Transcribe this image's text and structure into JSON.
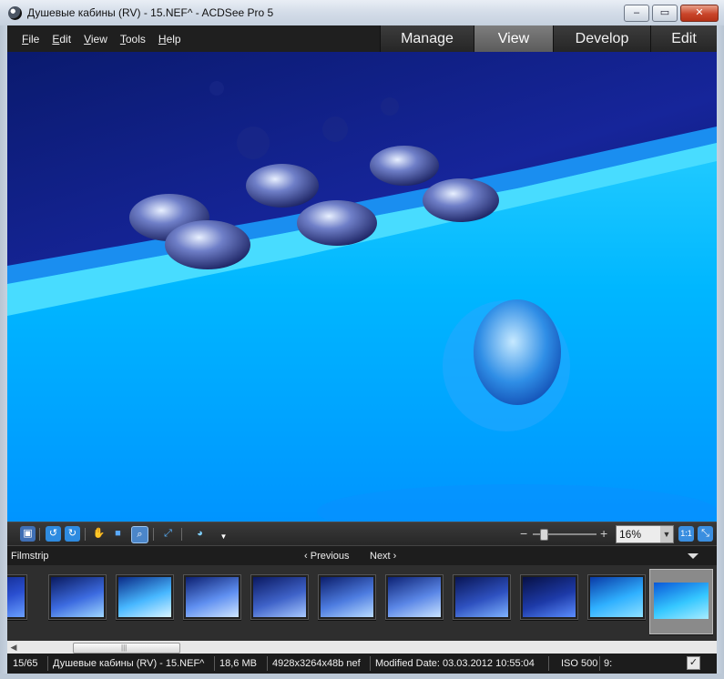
{
  "window": {
    "title": "Душевые кабины (RV) - 15.NEF^ - ACDSee Pro 5",
    "minimize_glyph": "‒",
    "maximize_glyph": "▭",
    "close_glyph": "✕"
  },
  "menu": [
    "File",
    "Edit",
    "View",
    "Tools",
    "Help"
  ],
  "mode_tabs": [
    {
      "label": "Manage",
      "active": false
    },
    {
      "label": "View",
      "active": true
    },
    {
      "label": "Develop",
      "active": false
    },
    {
      "label": "Edit",
      "active": false
    }
  ],
  "viewer_toolbar": {
    "icons": [
      "display-icon",
      "rotate-left-icon",
      "rotate-right-icon",
      "hand-tool-icon",
      "select-tool-icon",
      "zoom-tool-icon",
      "full-screen-icon",
      "color-palette-icon",
      "dropdown-arrow-icon",
      "actual-size-icon",
      "fit-to-window-icon"
    ],
    "zoom_minus": "−",
    "zoom_plus": "+",
    "zoom_value": "16%",
    "zoom_level": 0.12,
    "actual_size_label": "1:1"
  },
  "filmstrip": {
    "title": "Filmstrip",
    "previous_label": "Previous",
    "next_label": "Next",
    "thumbnail_count": 11,
    "selected_index": 10
  },
  "status": {
    "position": "15/65",
    "filename": "Душевые кабины (RV) - 15.NEF^",
    "filesize": "18,6 MB",
    "dimensions": "4928x3264x48b nef",
    "modified": "Modified Date: 03.03.2012 10:55:04",
    "iso": "ISO 500",
    "extra": "9:"
  },
  "colors": {
    "accent_blue": "#00c4ff",
    "dark_panel": "#1f1f1f",
    "active_tab": "#6b6b6b"
  }
}
